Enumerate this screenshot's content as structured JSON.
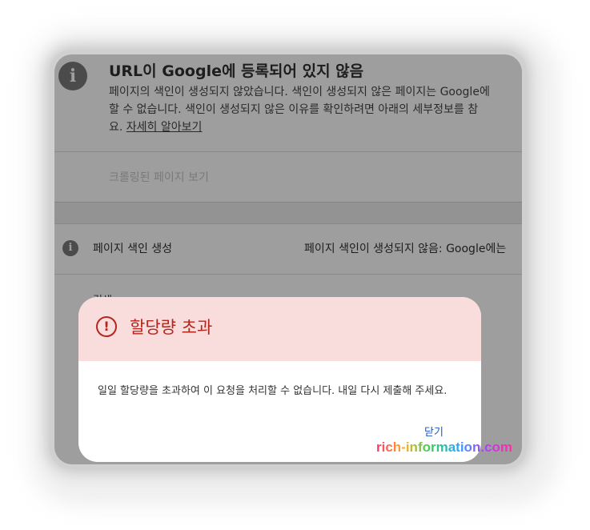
{
  "background_panel": {
    "title": "URL이 Google에 등록되어 있지 않음",
    "description_lines": [
      "페이지의 색인이 생성되지 않았습니다. 색인이 생성되지 않은 페이지는 Google에",
      "할 수 없습니다. 색인이 생성되지 않은 이유를 확인하려면 아래의 세부정보를 참",
      "요."
    ],
    "learn_more_link": "자세히 알아보기",
    "crawled_page_button": "크롤링된 페이지 보기",
    "indexing_label": "페이지 색인 생성",
    "indexing_value": "페이지 색인이 생성되지 않음: Google에는",
    "partial_row_label": "검색"
  },
  "dialog": {
    "title": "할당량 초과",
    "message": "일일 할당량을 초과하여 이 요청을 처리할 수 없습니다. 내일 다시 제출해 주세요.",
    "close_button": "닫기"
  },
  "watermark": "rich-information.com",
  "colors": {
    "overlay_gray": "#9e9e9e",
    "dialog_header": "#f9dcdc",
    "error_red": "#b3261e",
    "link_blue": "#1a55c7"
  },
  "icons": {
    "panel_icon": "info-icon",
    "dialog_icon": "alert-circle-icon"
  }
}
